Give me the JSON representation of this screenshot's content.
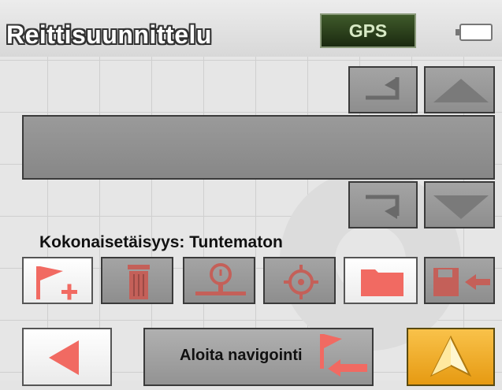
{
  "header": {
    "title": "Reittisuunnittelu",
    "gps_label": "GPS",
    "battery_icon": "battery-icon"
  },
  "route": {
    "address_value": "",
    "total_distance_label": "Kokonaisetäisyys: Tuntematon"
  },
  "toolbar": {
    "icons": [
      "add-destination-flag-icon",
      "delete-trash-icon",
      "route-options-icon",
      "target-crosshair-icon",
      "folder-icon",
      "save-route-icon"
    ]
  },
  "bottom": {
    "start_navigation_label": "Aloita navigointi"
  },
  "colors": {
    "accent_red": "#f16a62",
    "go_orange": "#f0ac2a",
    "gps_green": "#2c4419"
  }
}
